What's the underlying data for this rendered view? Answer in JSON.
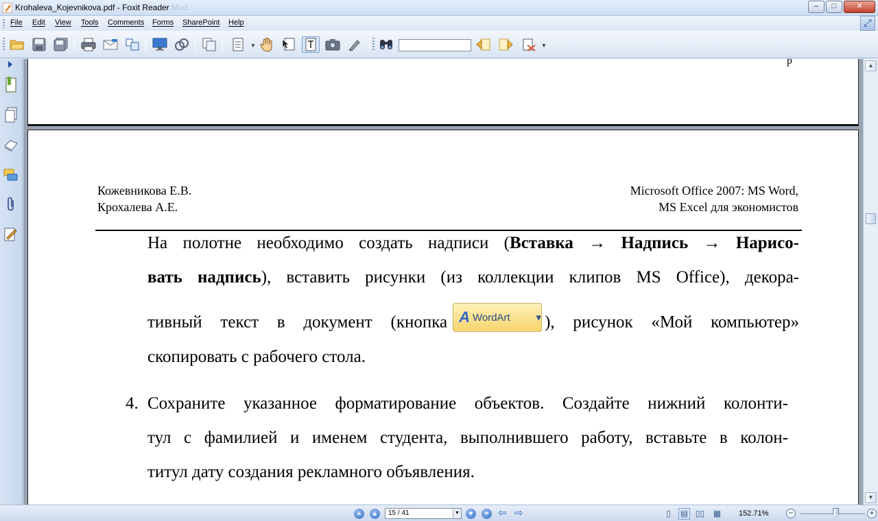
{
  "window": {
    "title": "Krohaleva_Kojevnikova.pdf - Foxit Reader",
    "title_faded": "Mod",
    "minimize": "–",
    "maximize": "□",
    "close": "✕"
  },
  "menu": {
    "file": "File",
    "edit": "Edit",
    "view": "View",
    "tools": "Tools",
    "comments": "Comments",
    "forms": "Forms",
    "sharepoint": "SharePoint",
    "help": "Help"
  },
  "toolbar": {
    "search_value": "",
    "icons": [
      "open-icon",
      "save-icon",
      "save-all-icon",
      "print-icon",
      "email-icon",
      "fit-page-icon",
      "monitor-icon",
      "properties-icon",
      "pages-icon",
      "text-view-icon",
      "hand-icon",
      "select-text-icon",
      "typewriter-icon",
      "snapshot-icon",
      "pen-icon",
      "find-icon",
      "find-prev-icon",
      "find-next-icon",
      "highlight-icon"
    ]
  },
  "document": {
    "top_stub": "р",
    "header_left": [
      "Кожевникова Е.В.",
      "Крохалева А.Е."
    ],
    "header_right": [
      "Microsoft Office 2007: MS Word,",
      "MS Excel для экономистов"
    ],
    "para1_line1_a": "На полотне необходимо создать надписи (",
    "para1_line1_b": "Вставка → Надпись → Нарисо-",
    "para1_line2_a": "вать надпись",
    "para1_line2_b": "), вставить рисунки (из коллекции клипов MS Office), декора-",
    "para1_line3_a": "тивный текст в документ (кнопка",
    "wordart_label": "WordArt",
    "para1_line3_b": "), рисунок «Мой компьютер»",
    "para1_line4": "скопировать с рабочего стола.",
    "item4_number": "4.",
    "item4_line1": "Сохраните указанное форматирование объектов. Создайте нижний колонти-",
    "item4_line2": "тул с фамилией и именем студента, выполнившего работу, вставьте в колон-",
    "item4_line3": "титул дату создания рекламного объявления."
  },
  "statusbar": {
    "page_indicator": "15 / 41",
    "zoom": "152.71%"
  }
}
